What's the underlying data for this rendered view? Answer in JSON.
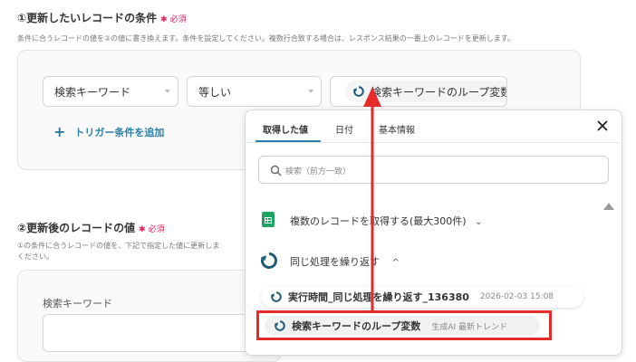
{
  "section1": {
    "title": "①更新したいレコードの条件",
    "required": "必須",
    "description": "条件に合うレコードの値を②の値に書き換えます。条件を設定してください。複数行合致する場合は、レスポンス結果の一番上のレコードを更新します。",
    "field_select": "検索キーワード",
    "operator_select": "等しい",
    "value_chip": "検索キーワードのループ変数",
    "add_condition": "トリガー条件を追加"
  },
  "section2": {
    "title": "②更新後のレコードの値",
    "required": "必須",
    "description_line1": "①の条件に合うレコードの値を、下記で指定した値に更新しま",
    "description_line2": "ください。",
    "field_label": "検索キーワード"
  },
  "popover": {
    "tabs": [
      "取得した値",
      "日付",
      "基本情報"
    ],
    "active_tab": 0,
    "search_placeholder": "検索（前方一致）",
    "groups": [
      {
        "label": "複数のレコードを取得する(最大300件)",
        "icon": "sheets-icon",
        "expanded": false
      },
      {
        "label": "同じ処理を繰り返す",
        "icon": "loop-icon",
        "expanded": true
      }
    ],
    "items": [
      {
        "label": "実行時間_同じ処理を繰り返す_136380",
        "meta": "2026-02-03 15:08"
      },
      {
        "label": "検索キーワードのループ変数",
        "meta": "生成AI 最新トレンド"
      }
    ]
  },
  "colors": {
    "accent": "#2a7fa8",
    "loop_icon": "#1f5c7a",
    "required": "#e0245e",
    "highlight": "#e52a2a",
    "sheets": "#1fa463"
  }
}
